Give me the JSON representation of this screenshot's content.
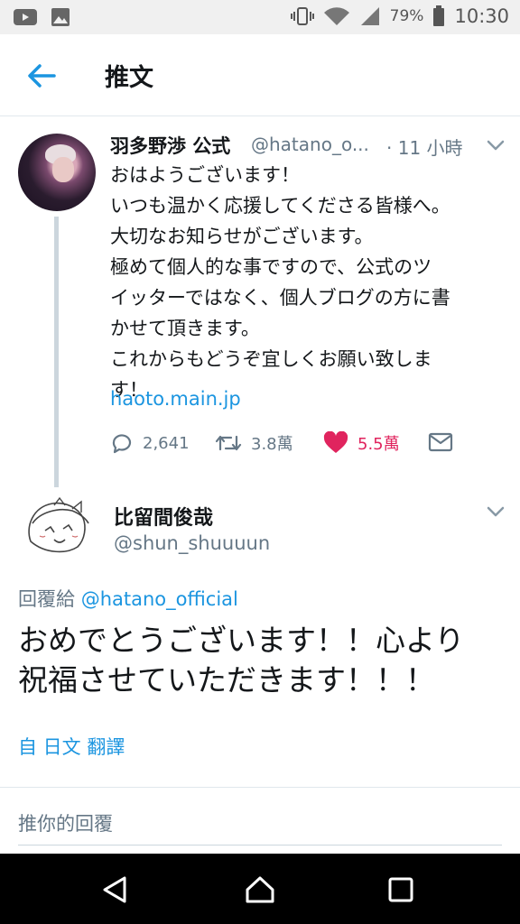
{
  "status_bar": {
    "battery": "79%",
    "time": "10:30",
    "icons": [
      "youtube-icon",
      "gallery-icon",
      "vibrate-icon",
      "wifi-icon",
      "signal-icon",
      "battery-icon"
    ]
  },
  "header": {
    "title": "推文"
  },
  "tweet": {
    "display_name": "羽多野渉 公式",
    "handle": "@hatano_o...",
    "time": "· 11 小時",
    "lines": [
      "おはようございます！",
      "いつも温かく応援してくださる皆様へ。",
      "大切なお知らせがございます。",
      "極めて個人的な事ですので、公式のツ",
      "イッターではなく、個人ブログの方に書",
      "かせて頂きます。",
      "これからもどうぞ宜しくお願い致しま",
      "す！"
    ],
    "link": "haoto.main.jp",
    "replies": "2,641",
    "retweets": "3.8萬",
    "likes": "5.5萬"
  },
  "reply": {
    "display_name": "比留間俊哉",
    "handle": "@shun_shuuuun",
    "reply_to_label": "回覆給",
    "reply_to_mention": "@hatano_official",
    "lines": [
      "おめでとうございます！！心より",
      "祝福させていただきます！！！"
    ],
    "translate": "自 日文 翻譯"
  },
  "composer": {
    "placeholder": "推你的回覆"
  },
  "colors": {
    "accent": "#1b95e0",
    "like": "#e0245e",
    "secondary_text": "#657786"
  }
}
